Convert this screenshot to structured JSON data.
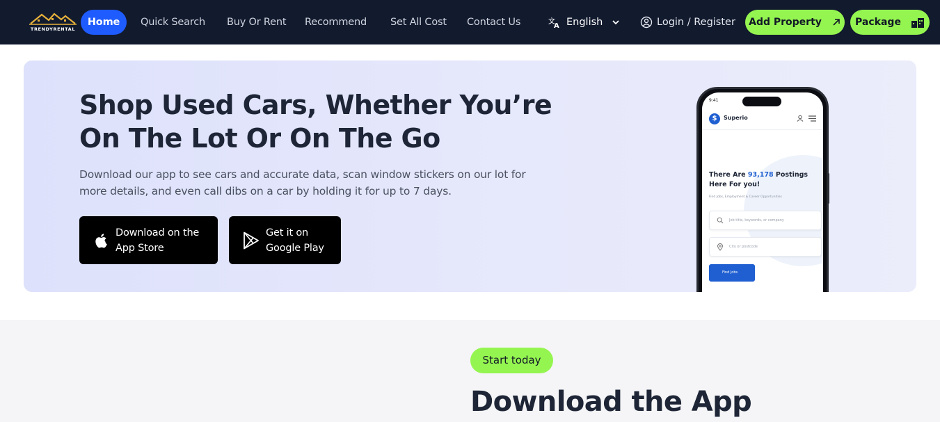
{
  "nav": {
    "logo_text": "TRENDYRENTAL",
    "links": [
      "Home",
      "Quick Search",
      "Buy Or Rent",
      "Recommend",
      "Set All Cost",
      "Contact Us"
    ],
    "language": "English",
    "login": "Login / Register",
    "add_property": "Add Property",
    "package": "Package"
  },
  "hero": {
    "title": "Shop Used Cars, Whether You’re On The Lot Or On The Go",
    "description": "Download our app to see cars and accurate data, scan window stickers on our lot for more details, and even call dibs on a car by holding it for up to 7 days.",
    "app_store": {
      "line1": "Download on the",
      "line2": "App Store"
    },
    "google_play": {
      "line1": "Get it on",
      "line2": "Google Play"
    }
  },
  "phone": {
    "time": "9:41",
    "app_name": "Superio",
    "headline_prefix": "There Are",
    "headline_number": "93,178",
    "headline_suffix": "Postings Here For you!",
    "subline": "Find Jobs, Employment & Career Opportunities",
    "search_placeholder": "Job title, keywords, or company",
    "location_placeholder": "City or postcode",
    "find_button": "Find Jobs"
  },
  "lower": {
    "badge": "Start today",
    "title": "Download the App"
  },
  "colors": {
    "nav_bg": "#121a2e",
    "accent_blue": "#1f5cff",
    "accent_green": "#95f550",
    "hero_bg": "#e3e6fb",
    "text_dark": "#1d2536"
  },
  "icons": {
    "translate": "translate-icon",
    "chevron": "chevron-down-icon",
    "user": "user-circle-icon",
    "arrow": "arrow-up-right-icon",
    "package": "package-icon",
    "apple": "apple-icon",
    "play": "play-store-icon"
  }
}
